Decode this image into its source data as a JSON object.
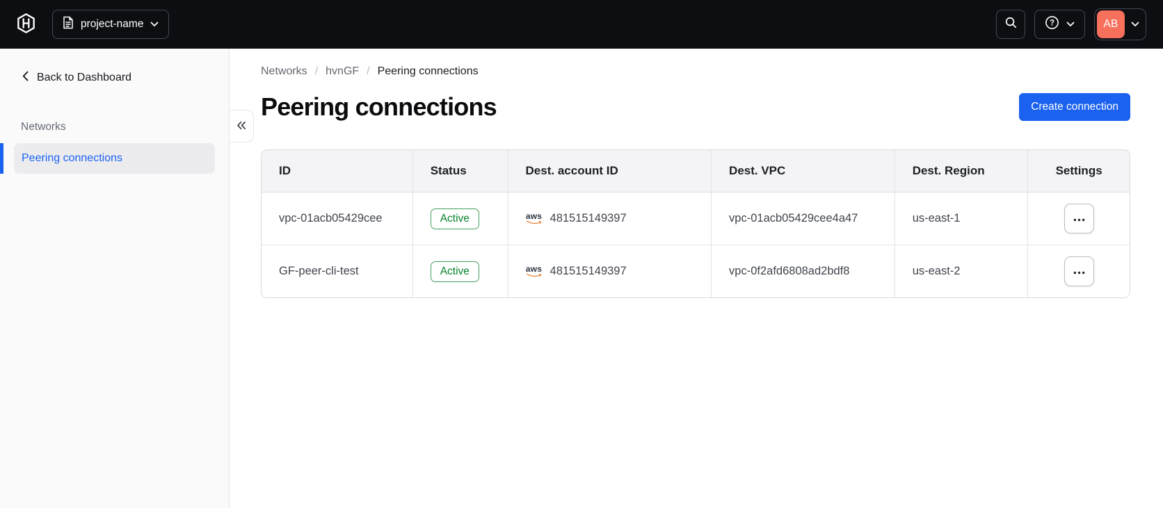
{
  "topbar": {
    "project_selector": {
      "label": "project-name"
    },
    "account_menu": {
      "initials": "AB"
    }
  },
  "sidebar": {
    "back_label": "Back to Dashboard",
    "section_label": "Networks",
    "items": [
      {
        "label": "Peering connections",
        "active": true
      }
    ]
  },
  "breadcrumb": {
    "items": [
      "Networks",
      "hvnGF",
      "Peering connections"
    ],
    "separator": "/"
  },
  "page": {
    "title": "Peering connections",
    "create_button_label": "Create connection"
  },
  "table": {
    "columns": [
      "ID",
      "Status",
      "Dest. account ID",
      "Dest. VPC",
      "Dest. Region",
      "Settings"
    ],
    "rows": [
      {
        "id": "vpc-01acb05429cee",
        "status": "Active",
        "provider": "aws",
        "account_id": "481515149397",
        "vpc": "vpc-01acb05429cee4a47",
        "region": "us-east-1"
      },
      {
        "id": "GF-peer-cli-test",
        "status": "Active",
        "provider": "aws",
        "account_id": "481515149397",
        "vpc": "vpc-0f2afd6808ad2bdf8",
        "region": "us-east-2"
      }
    ]
  },
  "icons": {
    "logo": "hashicorp-logo",
    "project": "document-icon",
    "search": "magnifier-icon",
    "help": "question-circle-icon",
    "collapse": "double-chevron-left-icon",
    "row_menu": "ellipsis-icon"
  },
  "colors": {
    "topbar_bg": "#0d0e12",
    "accent_blue": "#1b62f0",
    "avatar_orange": "#f7705c",
    "success_green": "#06832c",
    "aws_orange": "#e8883e"
  }
}
